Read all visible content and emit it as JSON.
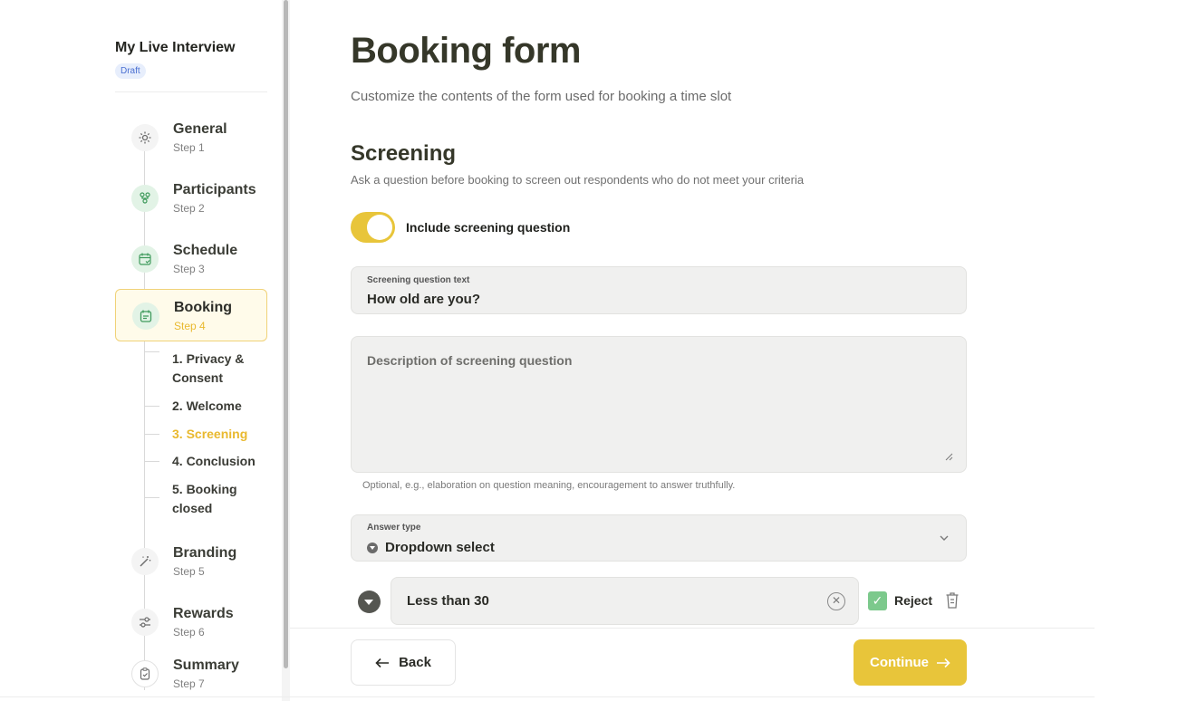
{
  "sidebar": {
    "project_title": "My Live Interview",
    "badge": "Draft",
    "steps": [
      {
        "label": "General",
        "sub": "Step 1",
        "icon": "gear-icon"
      },
      {
        "label": "Participants",
        "sub": "Step 2",
        "icon": "people-icon"
      },
      {
        "label": "Schedule",
        "sub": "Step 3",
        "icon": "calendar-icon"
      },
      {
        "label": "Booking",
        "sub": "Step 4",
        "icon": "booking-icon"
      },
      {
        "label": "Branding",
        "sub": "Step 5",
        "icon": "wand-icon"
      },
      {
        "label": "Rewards",
        "sub": "Step 6",
        "icon": "sliders-icon"
      },
      {
        "label": "Summary",
        "sub": "Step 7",
        "icon": "clipboard-icon"
      }
    ],
    "substeps": [
      "1. Privacy & Consent",
      "2. Welcome",
      "3. Screening",
      "4. Conclusion",
      "5. Booking closed"
    ],
    "active_step": "Booking",
    "current_substep": "3. Screening"
  },
  "main": {
    "title": "Booking form",
    "subtitle": "Customize the contents of the form used for booking a time slot",
    "section_title": "Screening",
    "section_subtitle": "Ask a question before booking to screen out respondents who do not meet your criteria",
    "toggle_label": "Include screening question",
    "toggle_on": true,
    "question_label": "Screening question text",
    "question_value": "How old are you?",
    "description_placeholder": "Description of screening question",
    "description_hint": "Optional, e.g., elaboration on question meaning, encouragement to answer truthfully.",
    "answer_type_label": "Answer type",
    "answer_type_value": "Dropdown select",
    "options": [
      {
        "value": "Less than 30",
        "reject": true,
        "reject_label": "Reject"
      }
    ],
    "back_label": "Back",
    "continue_label": "Continue"
  },
  "colors": {
    "accent": "#e8c53a",
    "active_step_border": "#f0d278",
    "reject_check": "#7cc98c",
    "draft_badge": "#4a6fd1"
  }
}
